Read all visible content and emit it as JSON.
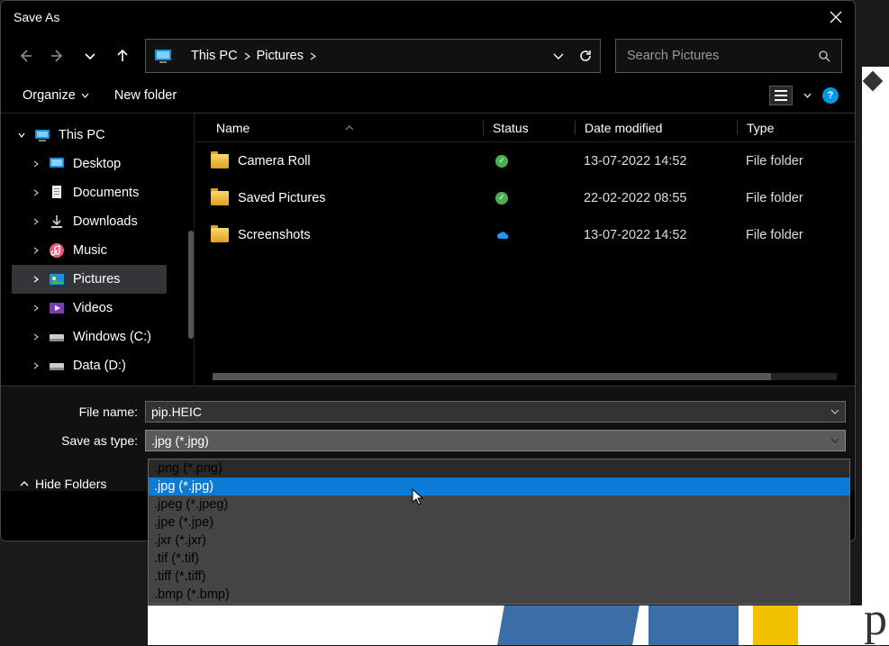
{
  "dialog": {
    "title": "Save As"
  },
  "breadcrumb": {
    "root": "This PC",
    "folder": "Pictures"
  },
  "search": {
    "placeholder": "Search Pictures"
  },
  "toolbar": {
    "organize": "Organize",
    "newfolder": "New folder"
  },
  "tree": {
    "root": "This PC",
    "items": [
      {
        "label": "Desktop"
      },
      {
        "label": "Documents"
      },
      {
        "label": "Downloads"
      },
      {
        "label": "Music"
      },
      {
        "label": "Pictures"
      },
      {
        "label": "Videos"
      },
      {
        "label": "Windows (C:)"
      },
      {
        "label": "Data (D:)"
      }
    ]
  },
  "columns": {
    "name": "Name",
    "status": "Status",
    "date": "Date modified",
    "type": "Type"
  },
  "files": [
    {
      "name": "Camera Roll",
      "status": "ok",
      "date": "13-07-2022 14:52",
      "type": "File folder"
    },
    {
      "name": "Saved Pictures",
      "status": "ok",
      "date": "22-02-2022 08:55",
      "type": "File folder"
    },
    {
      "name": "Screenshots",
      "status": "cloud",
      "date": "13-07-2022 14:52",
      "type": "File folder"
    }
  ],
  "fields": {
    "filename_label": "File name:",
    "filename_value": "pip.HEIC",
    "type_label": "Save as type:",
    "type_value": ".jpg (*.jpg)"
  },
  "hide_folders": "Hide Folders",
  "dropdown": [
    ".png (*.png)",
    ".jpg (*.jpg)",
    ".jpeg (*.jpeg)",
    ".jpe (*.jpe)",
    ".jxr (*.jxr)",
    ".tif (*.tif)",
    ".tiff (*.tiff)",
    ".bmp (*.bmp)"
  ]
}
